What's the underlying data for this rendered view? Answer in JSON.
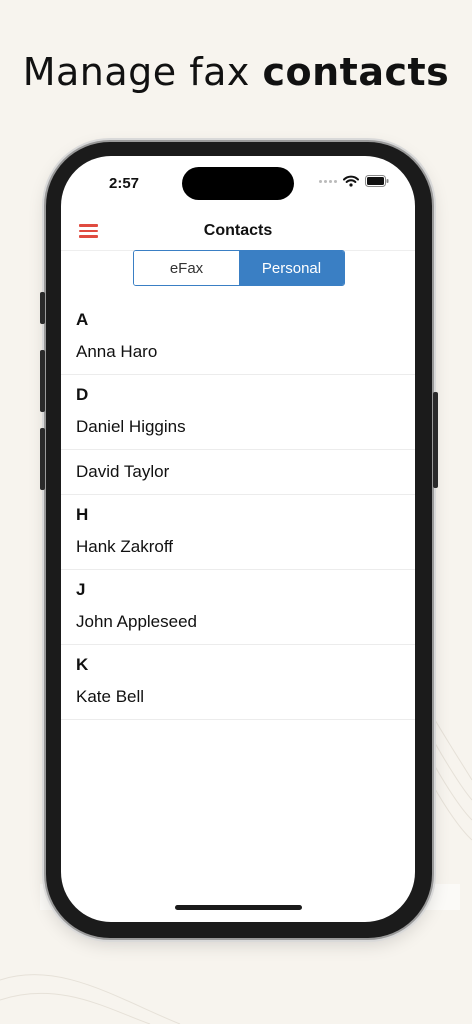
{
  "promo": {
    "headline_regular": "Manage fax ",
    "headline_bold": "contacts"
  },
  "status_bar": {
    "time": "2:57"
  },
  "nav": {
    "title": "Contacts"
  },
  "segments": {
    "efax": "eFax",
    "personal": "Personal",
    "selected": "Personal"
  },
  "sections": [
    {
      "letter": "A",
      "contacts": [
        "Anna Haro"
      ]
    },
    {
      "letter": "D",
      "contacts": [
        "Daniel Higgins",
        "David Taylor"
      ]
    },
    {
      "letter": "H",
      "contacts": [
        "Hank Zakroff"
      ]
    },
    {
      "letter": "J",
      "contacts": [
        "John Appleseed"
      ]
    },
    {
      "letter": "K",
      "contacts": [
        "Kate Bell"
      ]
    }
  ],
  "colors": {
    "accent": "#3a7fc4",
    "menu": "#e04b40",
    "background": "#f7f4ee"
  },
  "icons": [
    "menu-icon",
    "wifi-icon",
    "battery-icon",
    "signal-dots-icon"
  ]
}
